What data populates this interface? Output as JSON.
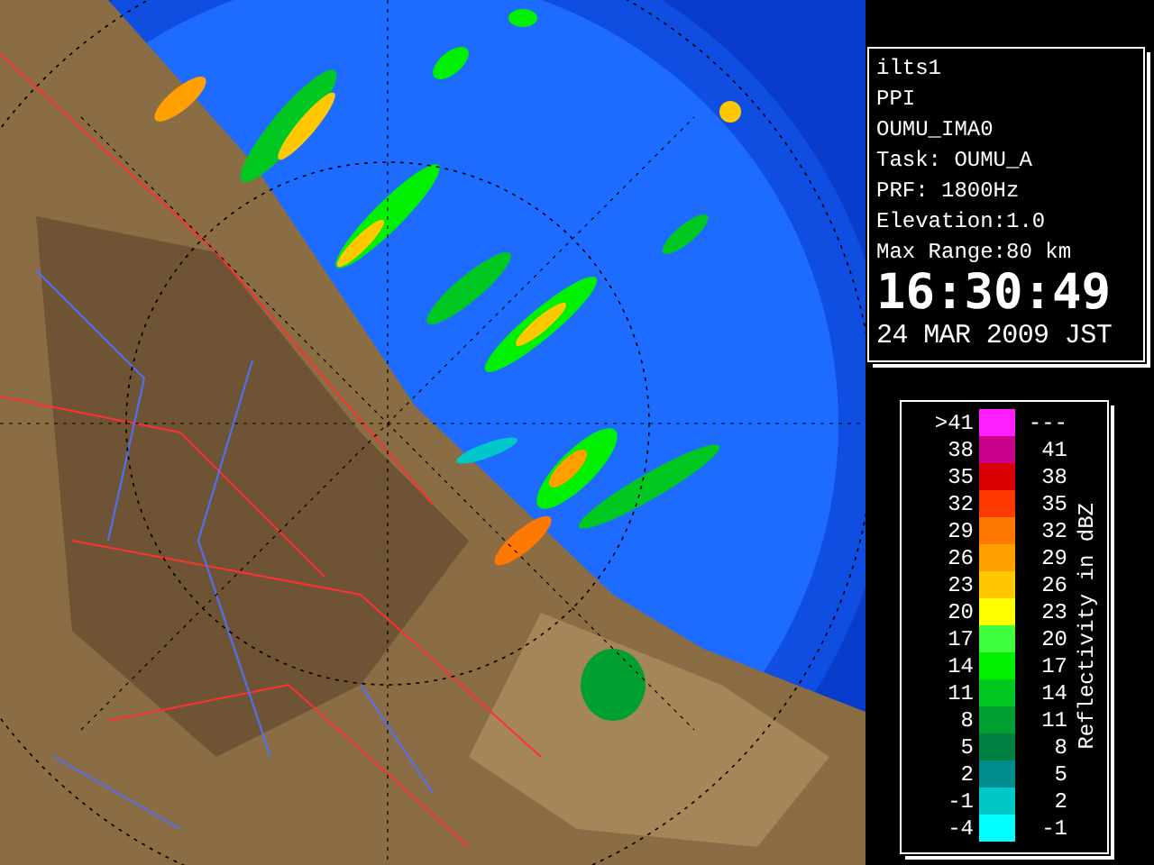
{
  "info": {
    "lines": [
      "ilts1",
      "PPI",
      "OUMU_IMA0",
      "Task: OUMU_A",
      "PRF: 1800Hz",
      "Elevation:1.0",
      "Max Range:80 km"
    ],
    "time": "16:30:49",
    "date": "24 MAR 2009 JST"
  },
  "legend": {
    "title": "Reflectivity in dBZ",
    "rows": [
      {
        "low": ">41",
        "high": "---",
        "color": "#ff20ff"
      },
      {
        "low": "38",
        "high": "41",
        "color": "#c8008c"
      },
      {
        "low": "35",
        "high": "38",
        "color": "#d80000"
      },
      {
        "low": "32",
        "high": "35",
        "color": "#ff3800"
      },
      {
        "low": "29",
        "high": "32",
        "color": "#ff7800"
      },
      {
        "low": "26",
        "high": "29",
        "color": "#ffa000"
      },
      {
        "low": "23",
        "high": "26",
        "color": "#ffc800"
      },
      {
        "low": "20",
        "high": "23",
        "color": "#ffff00"
      },
      {
        "low": "17",
        "high": "20",
        "color": "#40ff40"
      },
      {
        "low": "14",
        "high": "17",
        "color": "#00f000"
      },
      {
        "low": "11",
        "high": "14",
        "color": "#00c820"
      },
      {
        "low": "8",
        "high": "11",
        "color": "#00a030"
      },
      {
        "low": "5",
        "high": "8",
        "color": "#008040"
      },
      {
        "low": "2",
        "high": "5",
        "color": "#008c8c"
      },
      {
        "low": "-1",
        "high": "2",
        "color": "#00c8c8"
      },
      {
        "low": "-4",
        "high": "-1",
        "color": "#00ffff"
      }
    ]
  }
}
